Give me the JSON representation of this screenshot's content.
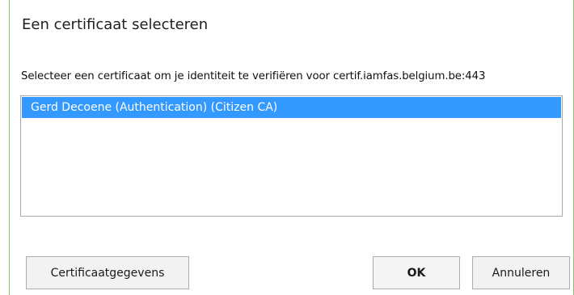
{
  "dialog": {
    "title": "Een certificaat selecteren",
    "prompt": "Selecteer een certificaat om je identiteit te verifiëren voor certif.iamfas.belgium.be:443"
  },
  "certificates": [
    {
      "label": "Gerd Decoene (Authentication) (Citizen CA)",
      "selected": true
    }
  ],
  "buttons": {
    "details": "Certificaatgegevens",
    "ok": "OK",
    "cancel": "Annuleren"
  },
  "colors": {
    "selection": "#3399ff",
    "frame_accent": "#8cc96a"
  }
}
